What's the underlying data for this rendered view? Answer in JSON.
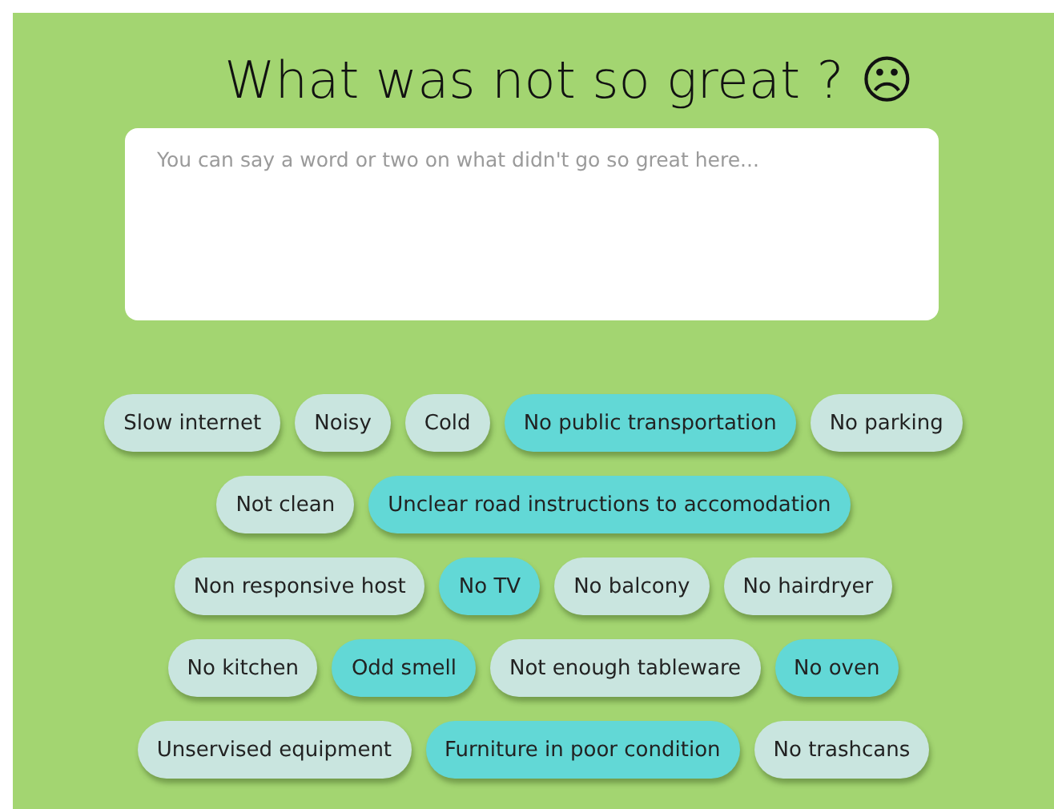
{
  "title": "What was not so great ? ☹",
  "feedback_field": {
    "placeholder": "You can say a word or two on what didn't go so great here..."
  },
  "tag_rows": [
    {
      "tags": [
        {
          "label": "Slow internet",
          "selected": false
        },
        {
          "label": "Noisy",
          "selected": false
        },
        {
          "label": "Cold",
          "selected": false
        },
        {
          "label": "No public transportation",
          "selected": true
        },
        {
          "label": "No parking",
          "selected": false
        }
      ]
    },
    {
      "tags": [
        {
          "label": "Not clean",
          "selected": false
        },
        {
          "label": "Unclear road instructions to accomodation",
          "selected": true
        }
      ]
    },
    {
      "tags": [
        {
          "label": "Non responsive host",
          "selected": false
        },
        {
          "label": "No TV",
          "selected": true
        },
        {
          "label": "No balcony",
          "selected": false
        },
        {
          "label": "No hairdryer",
          "selected": false
        }
      ]
    },
    {
      "tags": [
        {
          "label": "No kitchen",
          "selected": false
        },
        {
          "label": "Odd smell",
          "selected": true
        },
        {
          "label": "Not enough tableware",
          "selected": false
        },
        {
          "label": "No oven",
          "selected": true
        }
      ]
    },
    {
      "tags": [
        {
          "label": "Unservised equipment",
          "selected": false
        },
        {
          "label": "Furniture in poor condition",
          "selected": true
        },
        {
          "label": "No trashcans",
          "selected": false
        }
      ]
    }
  ]
}
